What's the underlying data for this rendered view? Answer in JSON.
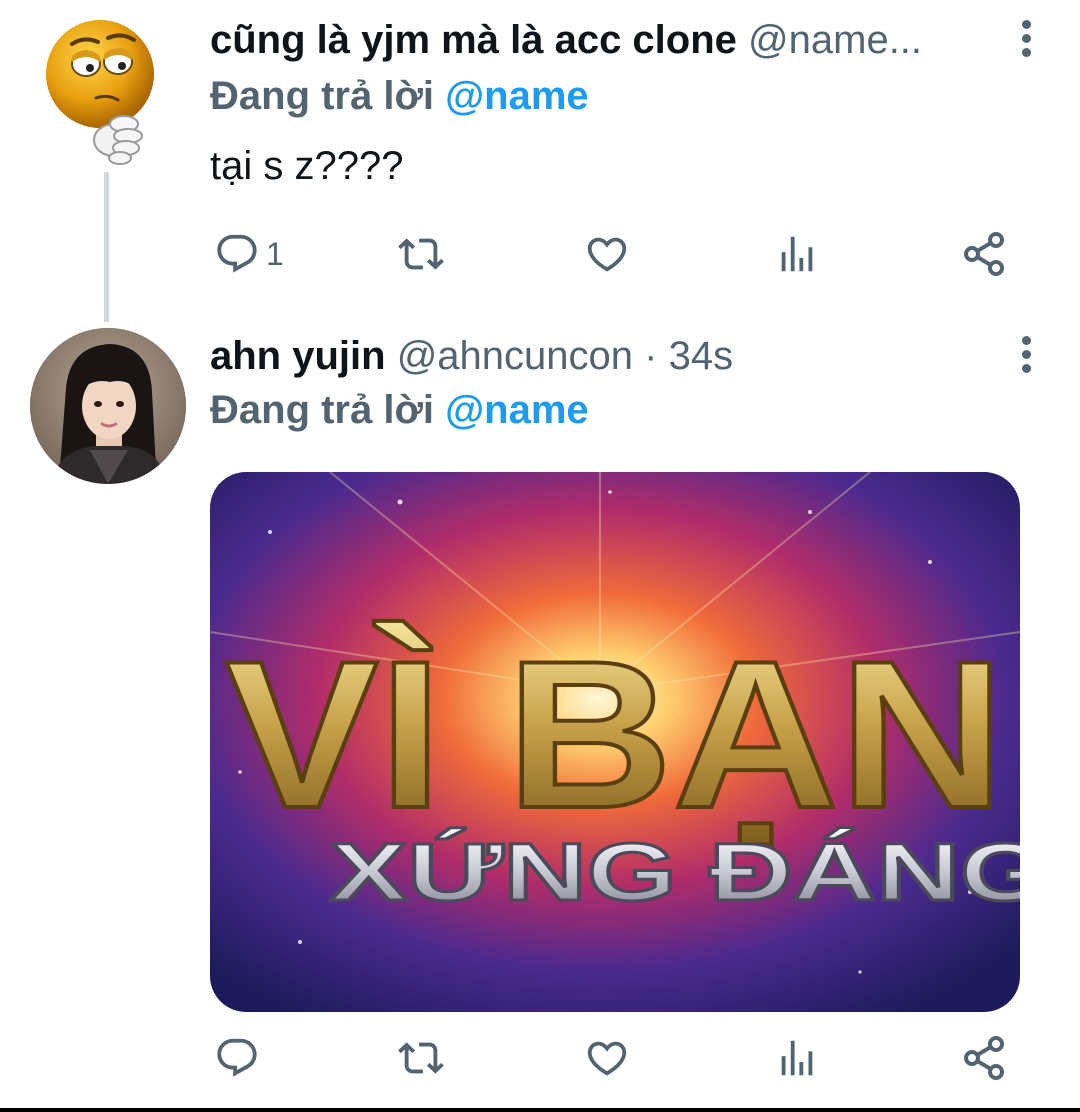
{
  "tweets": [
    {
      "display_name": "cũng là yjm mà là acc clone",
      "handle": "@name...",
      "replying_prefix": "Đang trả lời",
      "replying_to": "@name",
      "text": "tại s z????",
      "reply_count": "1",
      "avatar_icon": "thinking-smiley-emoji"
    },
    {
      "display_name": "ahn yujin",
      "handle": "@ahncuncon · 34s",
      "replying_prefix": "Đang trả lời",
      "replying_to": "@name",
      "media_text_line1": "VÌ BẠN",
      "media_text_line2": "XỨNG ĐÁNG",
      "avatar_icon": "profile-photo"
    }
  ],
  "colors": {
    "text_primary": "#0f1419",
    "text_secondary": "#536471",
    "accent_link": "#1d9bf0",
    "thread_line": "#cfd9de"
  }
}
